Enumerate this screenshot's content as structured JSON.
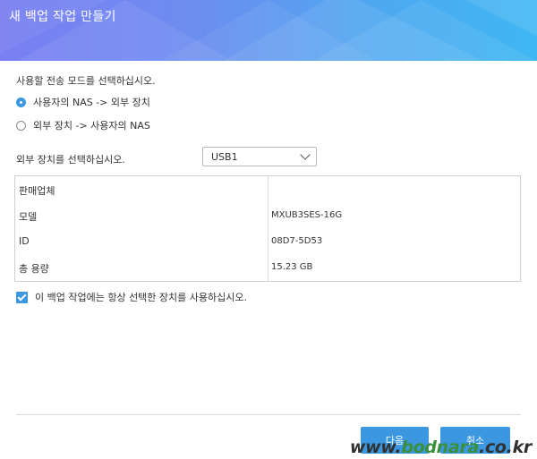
{
  "window": {
    "title": "새 백업 작업 만들기"
  },
  "mode": {
    "prompt": "사용할 전송 모드를 선택하십시오.",
    "options": [
      {
        "label": "사용자의 NAS -> 외부 장치",
        "checked": true
      },
      {
        "label": "외부 장치 -> 사용자의 NAS",
        "checked": false
      }
    ]
  },
  "device": {
    "prompt": "외부 장치를 선택하십시오.",
    "selected": "USB1"
  },
  "info": {
    "rows": [
      {
        "label": "판매업체",
        "value": ""
      },
      {
        "label": "모델",
        "value": "MXUB3SES-16G"
      },
      {
        "label": "ID",
        "value": "08D7-5D53"
      },
      {
        "label": "총 용량",
        "value": "15.23 GB"
      }
    ]
  },
  "always_use": {
    "label": "이 백업 작업에는 항상 선택한 장치를 사용하십시오.",
    "checked": true
  },
  "buttons": {
    "next": "다음",
    "cancel": "취소"
  },
  "watermark": {
    "prefix": "www.",
    "brand": "bodnara",
    "suffix": ".co.kr"
  },
  "colors": {
    "accent": "#3a97e0",
    "title_gradient_start": "#7a7ff2",
    "title_gradient_end": "#3fb7f2"
  }
}
